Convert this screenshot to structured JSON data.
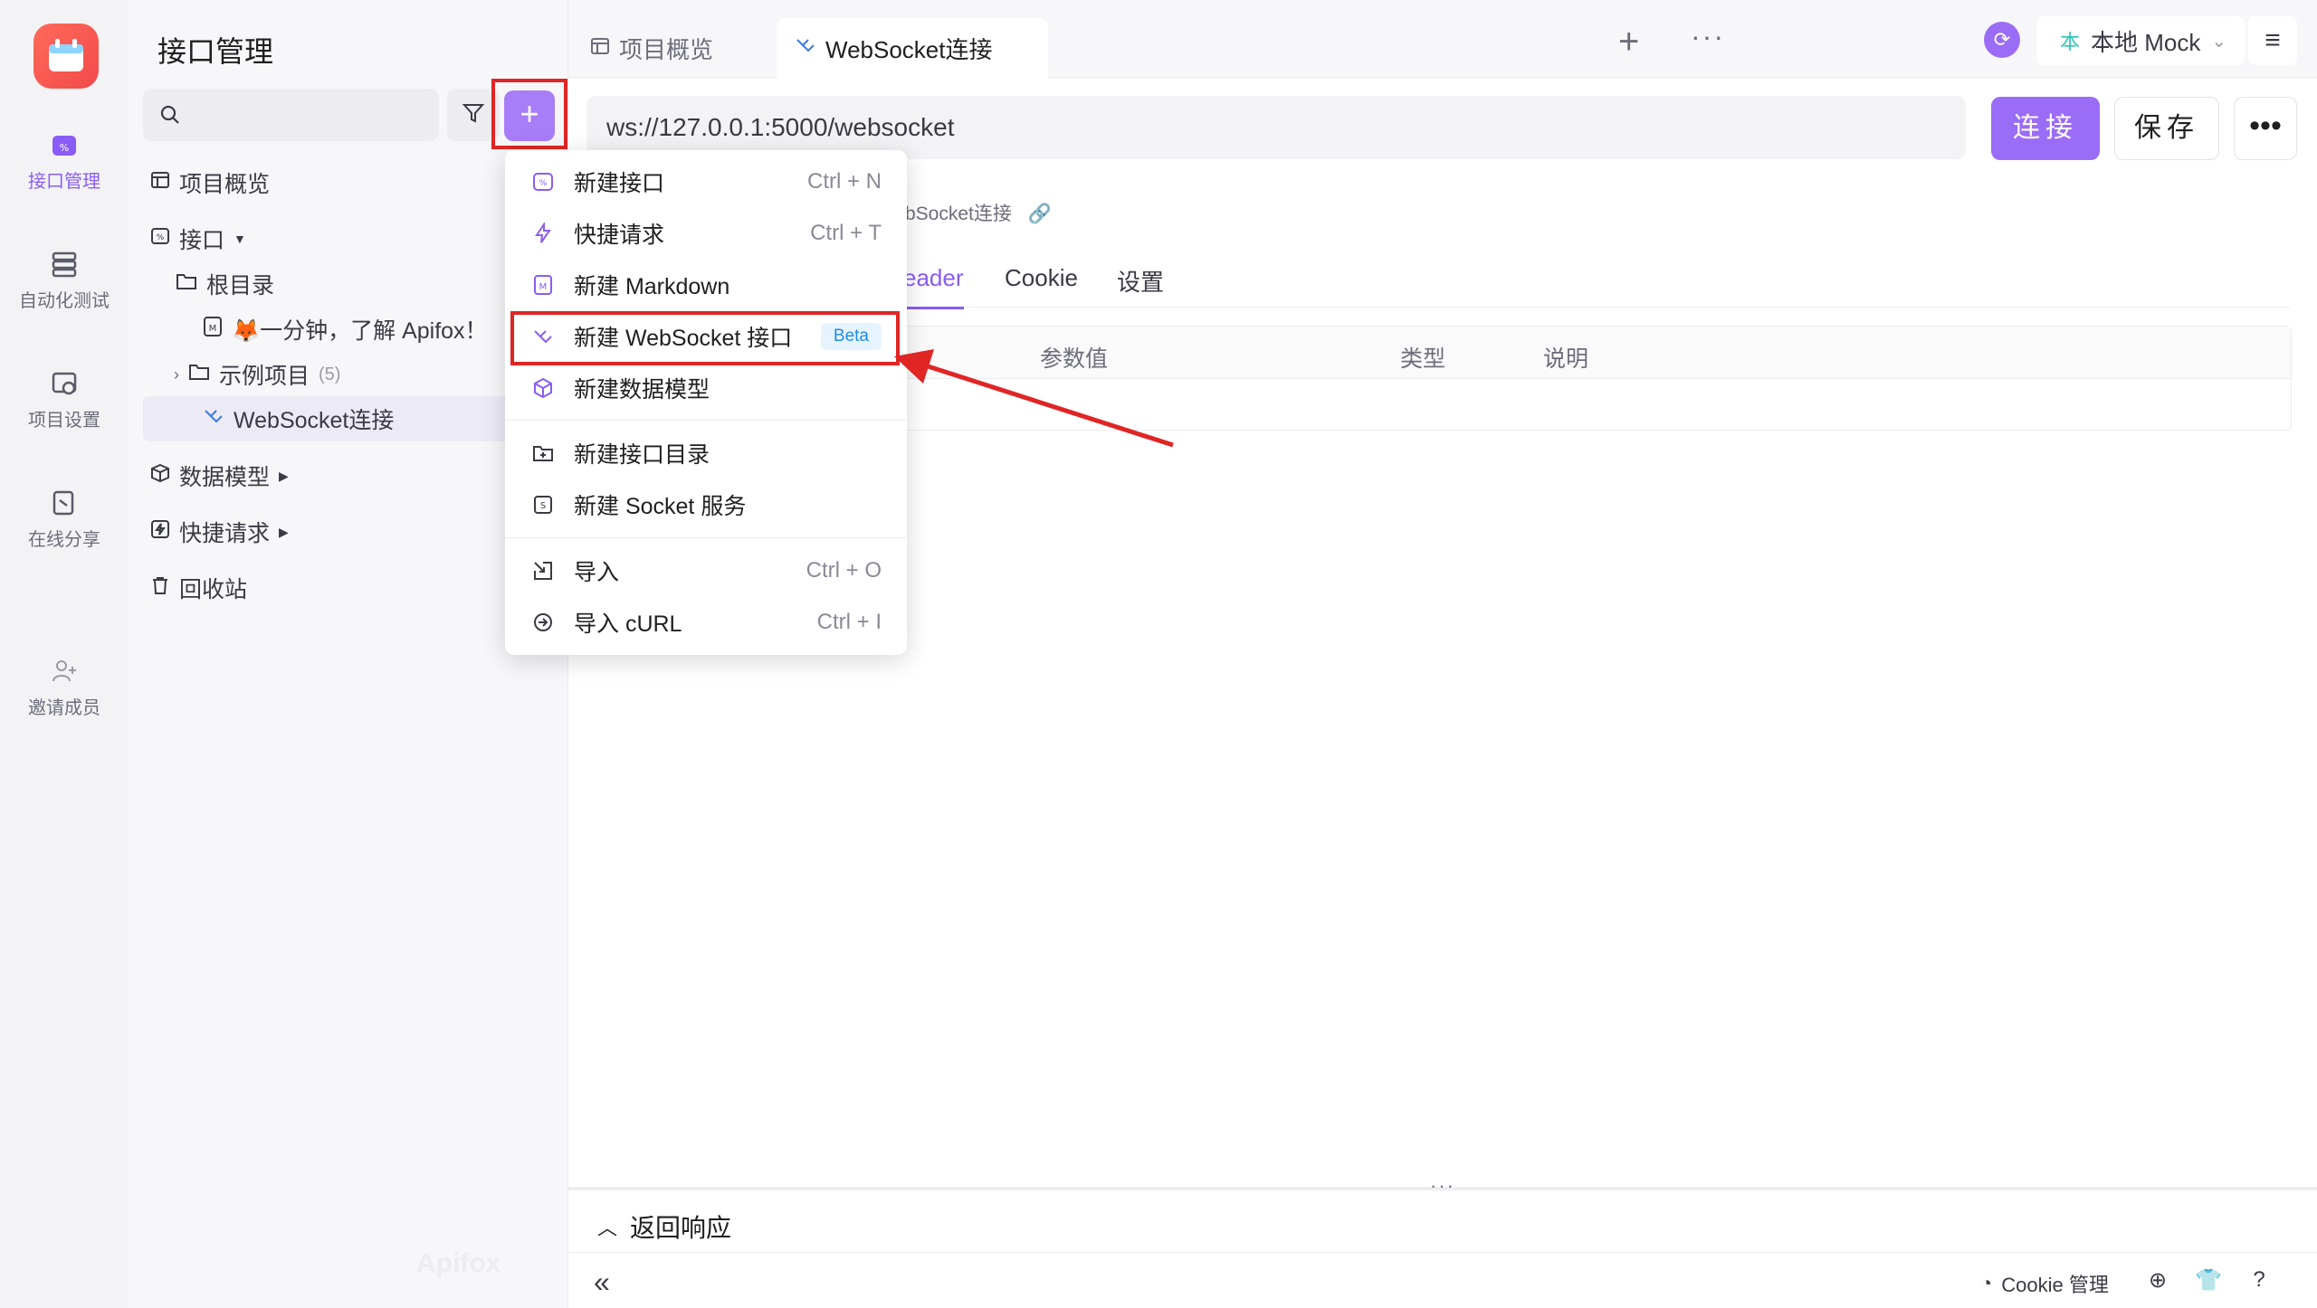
{
  "rail": {
    "items": [
      {
        "label": "接口管理",
        "icon": "api-icon"
      },
      {
        "label": "自动化测试",
        "icon": "automation-icon"
      },
      {
        "label": "项目设置",
        "icon": "settings-icon"
      },
      {
        "label": "在线分享",
        "icon": "share-icon"
      },
      {
        "label": "邀请成员",
        "icon": "invite-icon"
      }
    ],
    "active_color": "#8a5cf6"
  },
  "sidebar": {
    "title": "接口管理",
    "tree": {
      "overview": "项目概览",
      "apis": "接口",
      "root": "根目录",
      "doc": "🦊一分钟，了解 Apifox！",
      "examples": "示例项目",
      "examples_count": "(5)",
      "websocket": "WebSocket连接",
      "models": "数据模型",
      "quick": "快捷请求",
      "trash": "回收站"
    },
    "watermark": "Apifox"
  },
  "tabs": {
    "items": [
      {
        "label": "项目概览"
      },
      {
        "label": "WebSocket连接"
      }
    ],
    "plus": "+",
    "more": "···",
    "env": "本地 Mock",
    "env_badge": "本"
  },
  "request": {
    "url": "ws://127.0.0.1:5000/websocket",
    "connect": "连接",
    "save": "保存",
    "more": "•••",
    "breadcrumb": "bSocket连接",
    "subtabs": [
      "eader",
      "Cookie",
      "设置"
    ],
    "columns": [
      "参数值",
      "类型",
      "说明"
    ]
  },
  "dropdown": {
    "items": [
      {
        "label": "新建接口",
        "shortcut": "Ctrl + N",
        "icon": "api-icon"
      },
      {
        "label": "快捷请求",
        "shortcut": "Ctrl + T",
        "icon": "lightning-icon"
      },
      {
        "label": "新建 Markdown",
        "shortcut": "",
        "icon": "markdown-icon"
      },
      {
        "label": "新建 WebSocket 接口",
        "badge": "Beta",
        "icon": "websocket-icon"
      },
      {
        "label": "新建数据模型",
        "shortcut": "",
        "icon": "cube-icon"
      },
      {
        "label": "新建接口目录",
        "shortcut": "",
        "icon": "folder-plus-icon"
      },
      {
        "label": "新建 Socket 服务",
        "shortcut": "",
        "icon": "socket-icon"
      },
      {
        "label": "导入",
        "shortcut": "Ctrl + O",
        "icon": "import-icon"
      },
      {
        "label": "导入 cURL",
        "shortcut": "Ctrl + I",
        "icon": "curl-icon"
      }
    ]
  },
  "response": {
    "title": "返回响应",
    "dots": "···",
    "cookie_mgr": "Cookie 管理",
    "collapse": "«"
  }
}
